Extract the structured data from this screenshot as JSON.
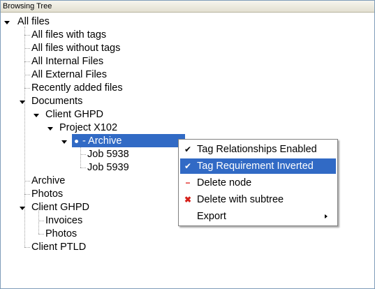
{
  "panel": {
    "title": "Browsing Tree"
  },
  "tree": {
    "all_files": "All files",
    "with_tags": "All files with tags",
    "without_tags": "All files without tags",
    "internal": "All Internal Files",
    "external": "All External Files",
    "recent": "Recently added files",
    "documents": "Documents",
    "client_ghpd_1": "Client GHPD",
    "project": "Project X102",
    "archive_selected": "- Archive",
    "job1": "Job 5938",
    "job2": "Job 5939",
    "archive": "Archive",
    "photos": "Photos",
    "client_ghpd_2": "Client GHPD",
    "invoices": "Invoices",
    "photos_sub": "Photos",
    "client_ptld": "Client PTLD"
  },
  "context_menu": {
    "items": [
      {
        "label": "Tag Relationships Enabled",
        "icon": "check-icon",
        "checked": true
      },
      {
        "label": "Tag Requirement Inverted",
        "icon": "check-icon",
        "checked": true,
        "highlighted": true
      },
      {
        "label": "Delete node",
        "icon": "minus-icon"
      },
      {
        "label": "Delete with subtree",
        "icon": "delete-x-icon"
      },
      {
        "label": "Export",
        "icon": "",
        "has_submenu": true
      }
    ]
  },
  "colors": {
    "selection": "#316ac5",
    "delete_icon": "#d6201a"
  }
}
